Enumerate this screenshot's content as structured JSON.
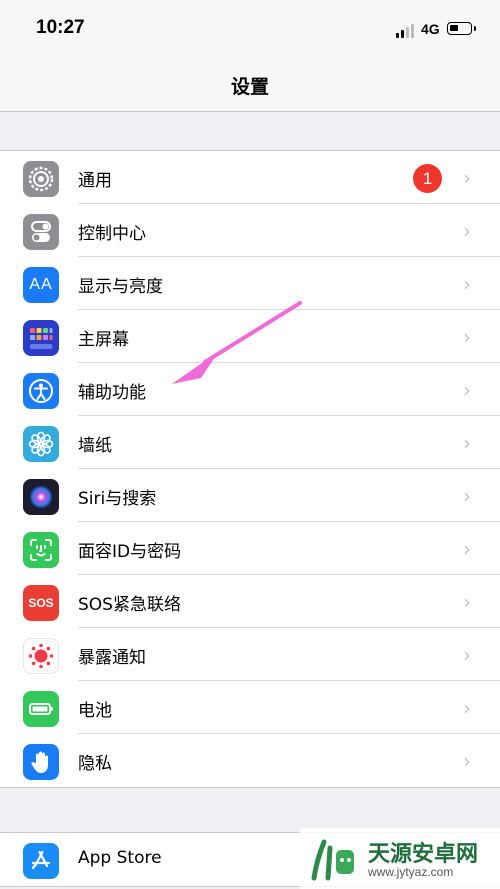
{
  "status": {
    "time": "10:27",
    "network": "4G"
  },
  "nav": {
    "title": "设置"
  },
  "group1": [
    {
      "label": "通用",
      "icon": "gear-icon",
      "color": "#8e8e93",
      "badge": "1"
    },
    {
      "label": "控制中心",
      "icon": "toggles-icon",
      "color": "#8e8e93"
    },
    {
      "label": "显示与亮度",
      "icon": "text-size-icon",
      "color": "#1a7cf5"
    },
    {
      "label": "主屏幕",
      "icon": "home-grid-icon",
      "color": "#2b3cc9"
    },
    {
      "label": "辅助功能",
      "icon": "accessibility-icon",
      "color": "#1a7cf5"
    },
    {
      "label": "墙纸",
      "icon": "flower-icon",
      "color": "#35aadc"
    },
    {
      "label": "Siri与搜索",
      "icon": "siri-icon",
      "color": "#1c1c2e"
    },
    {
      "label": "面容ID与密码",
      "icon": "face-id-icon",
      "color": "#34c759"
    },
    {
      "label": "SOS紧急联络",
      "icon": "sos-icon",
      "color": "#ea3d33"
    },
    {
      "label": "暴露通知",
      "icon": "exposure-icon",
      "color": "#ffffff"
    },
    {
      "label": "电池",
      "icon": "battery-icon",
      "color": "#34c759"
    },
    {
      "label": "隐私",
      "icon": "hand-icon",
      "color": "#1a7cf5"
    }
  ],
  "group2": [
    {
      "label": "App Store",
      "icon": "app-store-icon",
      "color": "#1a8cf5"
    }
  ],
  "icons": {
    "sos_text": "SOS",
    "text_size": "AA"
  },
  "watermark": {
    "brand": "天源安卓网",
    "url": "www.jytyaz.com"
  }
}
